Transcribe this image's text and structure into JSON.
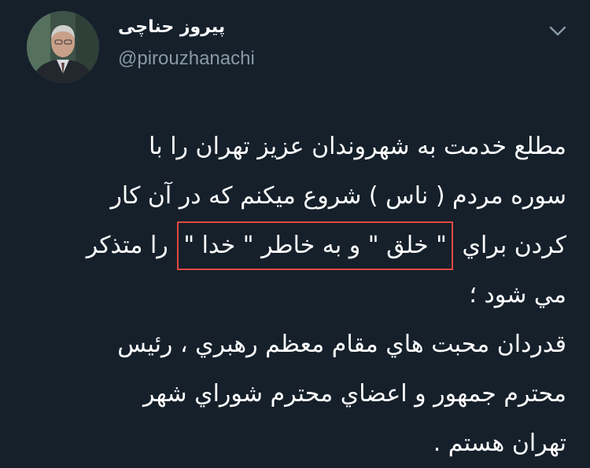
{
  "tweet": {
    "author": {
      "display_name": "پیروز حناچی",
      "handle": "@pirouzhanachi",
      "avatar_icon": "profile-photo-icon"
    },
    "menu_icon": "chevron-down-icon",
    "body": {
      "line1": "مطلع خدمت به شهروندان عزیز تهران را با",
      "line2": "سوره مردم ( ناس ) شروع میکنم که در آن کار",
      "line3_prefix": "کردن براي",
      "line3_highlight": "\" خلق \" و به خاطر \" خدا \"",
      "line3_suffix": "را متذکر",
      "line4": "مي شود ؛",
      "line5": "قدردان محبت هاي مقام معظم رهبري ، رئیس",
      "line6": "محترم جمهور و اعضاي محترم شوراي شهر",
      "line7": "تهران هستم ."
    },
    "colors": {
      "background": "#15202b",
      "text": "#ffffff",
      "secondary_text": "#8899a6",
      "highlight_border": "#e04a40"
    }
  }
}
